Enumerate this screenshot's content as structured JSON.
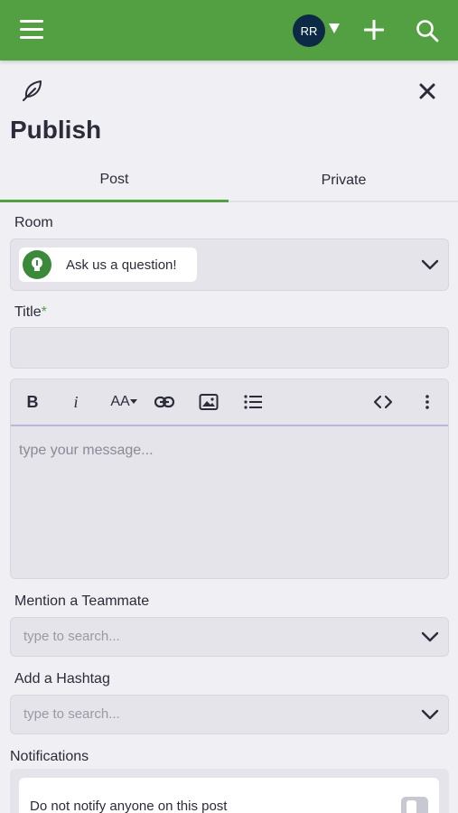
{
  "header": {
    "avatar_initials": "RR",
    "brand_color": "#53a043"
  },
  "page": {
    "title": "Publish"
  },
  "tabs": [
    {
      "label": "Post",
      "active": true
    },
    {
      "label": "Private",
      "active": false
    }
  ],
  "form": {
    "room_label": "Room",
    "room_value": "Ask us a question!",
    "title_label": "Title",
    "title_required_mark": "*",
    "title_value": "",
    "editor_placeholder": "type your message...",
    "mention_label": "Mention a Teammate",
    "mention_placeholder": "type to search...",
    "hashtag_label": "Add a Hashtag",
    "hashtag_placeholder": "type to search...",
    "notifications_label": "Notifications",
    "notify_option": "Do not notify anyone on this post",
    "notify_toggle_on": false
  },
  "editor_toolbar": {
    "bold": "B",
    "italic": "i",
    "font_size": "AA"
  },
  "icons": [
    "menu-icon",
    "chevron-down-icon",
    "plus-icon",
    "search-icon",
    "feather-icon",
    "close-icon",
    "link-icon",
    "image-icon",
    "list-icon",
    "code-icon",
    "more-vertical-icon"
  ]
}
